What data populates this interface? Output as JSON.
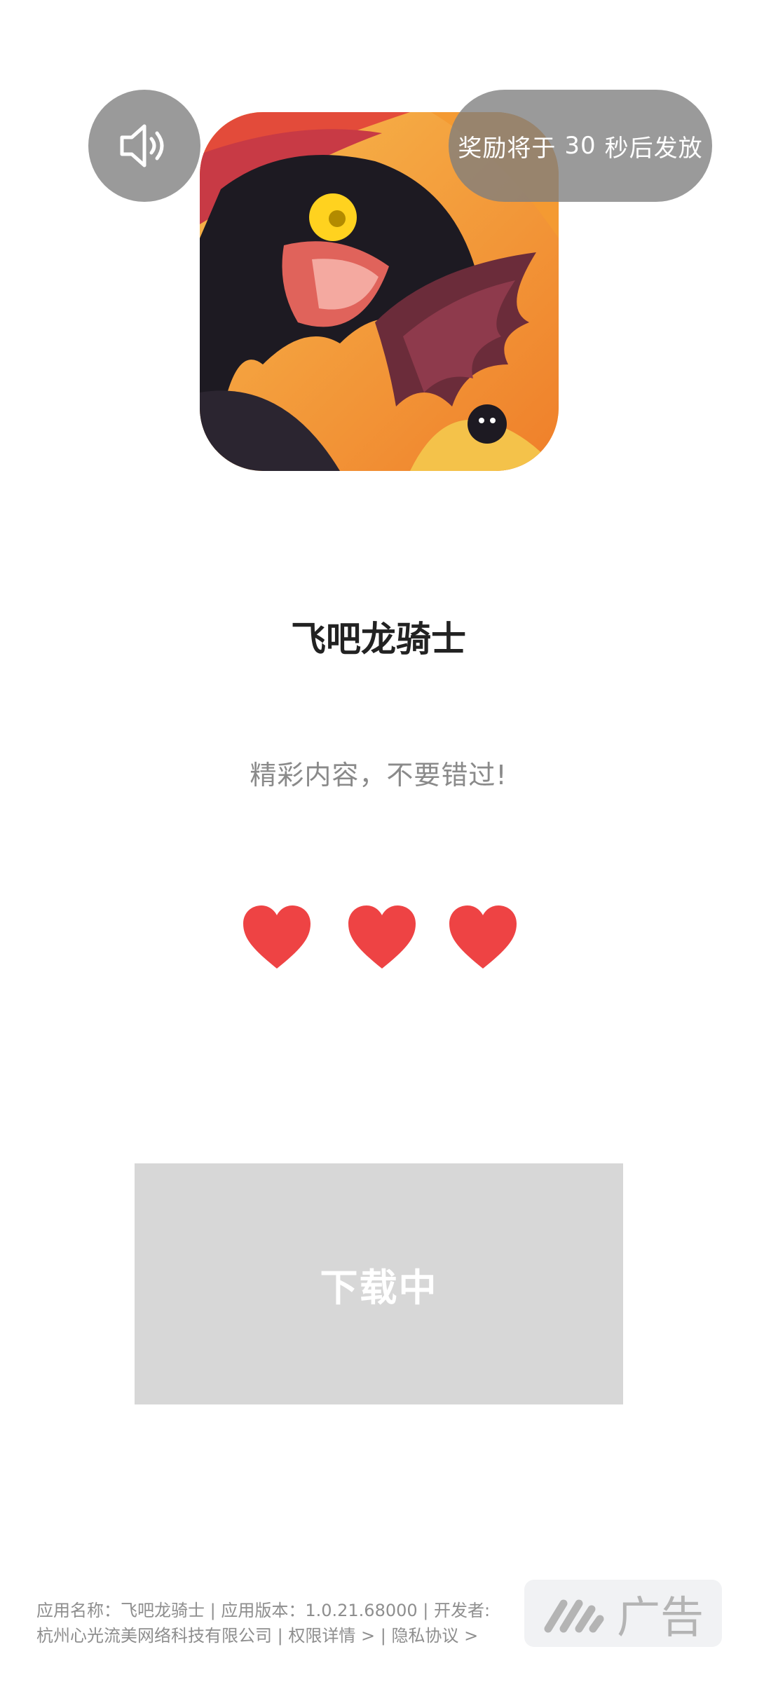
{
  "app": {
    "name": "飞吧龙骑士",
    "icon": "dragon-app-icon"
  },
  "overlay": {
    "sound_icon": "speaker-icon",
    "reward_prefix": "奖励将于",
    "reward_seconds": "30",
    "reward_suffix": "秒后发放"
  },
  "content": {
    "title": "飞吧龙骑士",
    "tagline": "精彩内容，不要错过!"
  },
  "hearts": {
    "count": 3,
    "icon": "heart-icon",
    "color": "#ee4344"
  },
  "download": {
    "label": "下载中",
    "color": "#d7d7d7"
  },
  "footer": {
    "line1": "应用名称：飞吧龙骑士 | 应用版本：1.0.21.68000 | 开发者:",
    "developer": "杭州心光流美网络科技有限公司",
    "separator1": " | ",
    "permissions_link": "权限详情 >",
    "separator2": " | ",
    "privacy_link": "隐私协议 >"
  },
  "ad_badge": {
    "label": "广告",
    "logo": "ad-logo-icon"
  }
}
